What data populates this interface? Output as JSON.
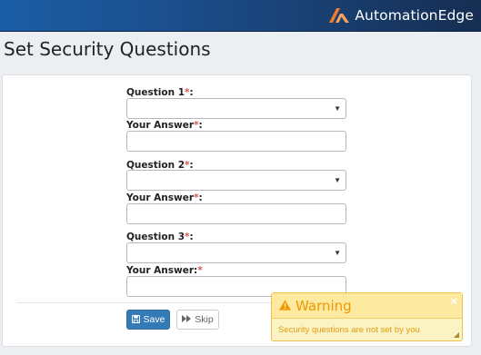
{
  "header": {
    "logo_text": "AutomationEdge",
    "logo_icon": "automationedge-logo-icon"
  },
  "page": {
    "title": "Set Security Questions"
  },
  "form": {
    "q1_label": "Question 1",
    "q2_label": "Question 2",
    "q3_label": "Question 3",
    "answer1_label": "Your Answer",
    "answer2_label": "Your Answer",
    "answer3_label": "Your Answer:",
    "required_mark": "*",
    "colon": ":",
    "q1_value": "",
    "q2_value": "",
    "q3_value": "",
    "a1_value": "",
    "a2_value": "",
    "a3_value": ""
  },
  "buttons": {
    "save_label": "Save",
    "save_icon": "floppy-disk-icon",
    "skip_label": "Skip",
    "skip_icon": "fast-forward-icon"
  },
  "toast": {
    "title": "Warning",
    "icon": "warning-triangle-icon",
    "message": "Security questions are not set by you",
    "close_glyph": "×"
  },
  "colors": {
    "header_gradient_start": "#1b5ea6",
    "header_gradient_end": "#162e52",
    "logo_accent": "#f07b2a",
    "primary_button": "#337ab7",
    "required_red": "#d9534f",
    "warning_bg": "#fcf3c4",
    "warning_text": "#ee9800"
  }
}
